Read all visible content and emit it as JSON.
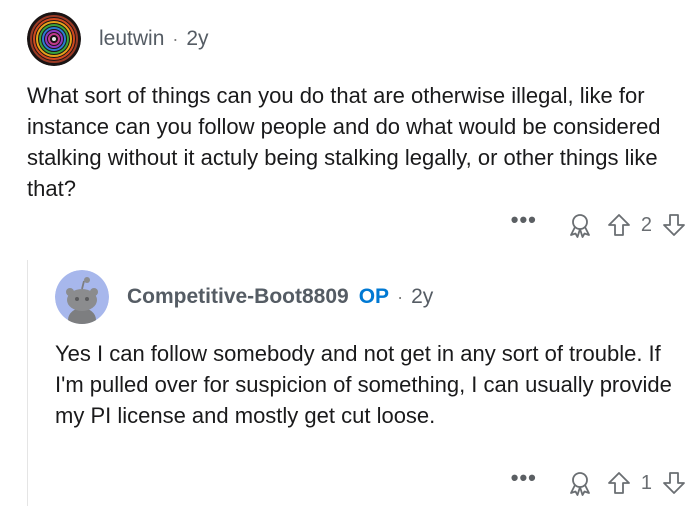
{
  "comments": [
    {
      "username": "leutwin",
      "age": "2y",
      "body": "What sort of things can you do that are otherwise illegal, like for instance can you follow people and do what would be considered stalking without it actuly being stalking legally, or other things like that?",
      "score": "2",
      "more_label": "•••"
    },
    {
      "username": "Competitive-Boot8809",
      "op_label": "OP",
      "age": "2y",
      "body": "Yes I can follow somebody and not get in any sort of trouble. If I'm pulled over for suspicion of something, I can usually provide my PI license and mostly get cut loose.",
      "score": "1",
      "more_label": "•••"
    }
  ],
  "separator": "·",
  "icons": {
    "award": "award-icon",
    "upvote": "upvote-arrow-icon",
    "downvote": "downvote-arrow-icon",
    "avatar1": "concentric-rings-avatar",
    "avatar2": "snoo-avatar"
  },
  "colors": {
    "op": "#0079d3",
    "meta": "#555c64",
    "text": "#1a1a1b",
    "avatar2_bg": "#a7b7ec"
  }
}
